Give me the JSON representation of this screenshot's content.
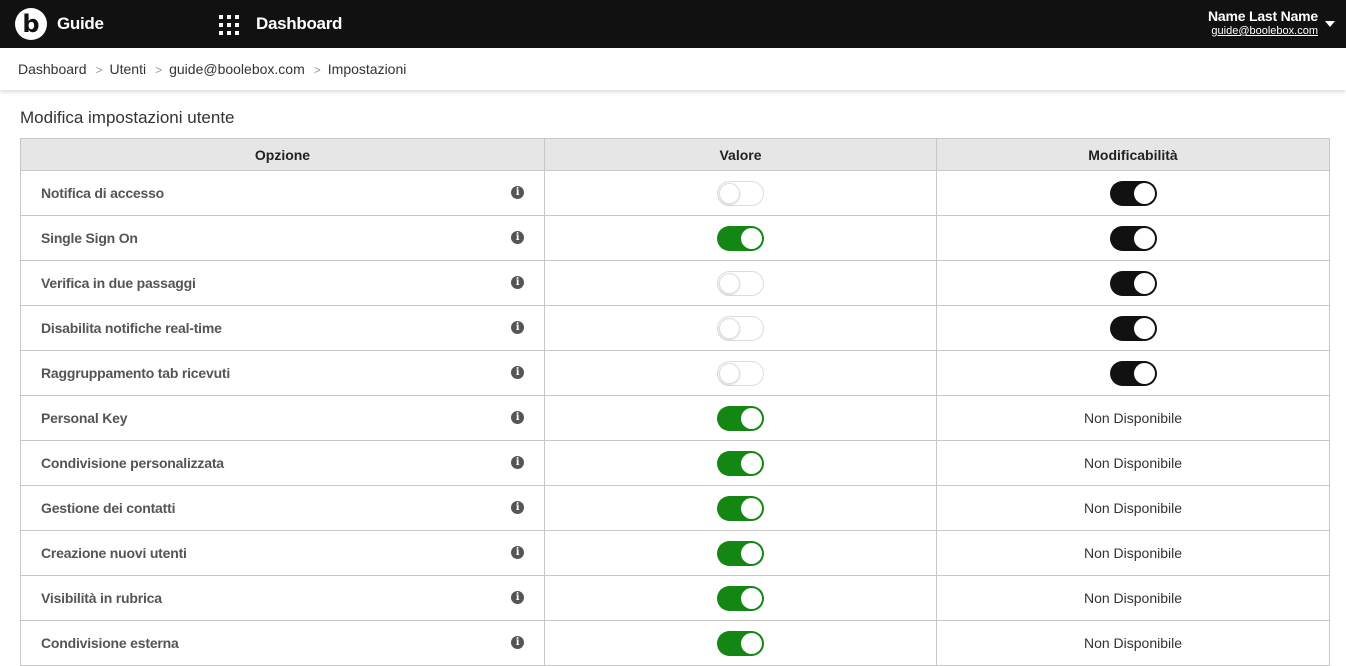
{
  "header": {
    "logo_letter": "b",
    "app_name": "Guide",
    "section_name": "Dashboard",
    "user_name": "Name Last Name",
    "user_email": "guide@boolebox.com"
  },
  "breadcrumb": [
    "Dashboard",
    "Utenti",
    "guide@boolebox.com",
    "Impostazioni"
  ],
  "breadcrumb_separator": ">",
  "page_title": "Modifica impostazioni utente",
  "table": {
    "columns": [
      "Opzione",
      "Valore",
      "Modificabilità"
    ],
    "info_glyph": "i",
    "rows": [
      {
        "option": "Notifica di accesso",
        "value": false,
        "editable": "on"
      },
      {
        "option": "Single Sign On",
        "value": true,
        "editable": "on"
      },
      {
        "option": "Verifica in due passaggi",
        "value": false,
        "editable": "on"
      },
      {
        "option": "Disabilita notifiche real-time",
        "value": false,
        "editable": "on"
      },
      {
        "option": "Raggruppamento tab ricevuti",
        "value": false,
        "editable": "on"
      },
      {
        "option": "Personal Key",
        "value": true,
        "editable": "Non Disponibile"
      },
      {
        "option": "Condivisione personalizzata",
        "value": true,
        "editable": "Non Disponibile"
      },
      {
        "option": "Gestione dei contatti",
        "value": true,
        "editable": "Non Disponibile"
      },
      {
        "option": "Creazione nuovi utenti",
        "value": true,
        "editable": "Non Disponibile"
      },
      {
        "option": "Visibilità in rubrica",
        "value": true,
        "editable": "Non Disponibile"
      },
      {
        "option": "Condivisione esterna",
        "value": true,
        "editable": "Non Disponibile"
      }
    ]
  },
  "colors": {
    "topbar": "#111111",
    "toggle_on_value": "#138613",
    "toggle_on_editable": "#111111",
    "header_row": "#e6e6e6"
  }
}
